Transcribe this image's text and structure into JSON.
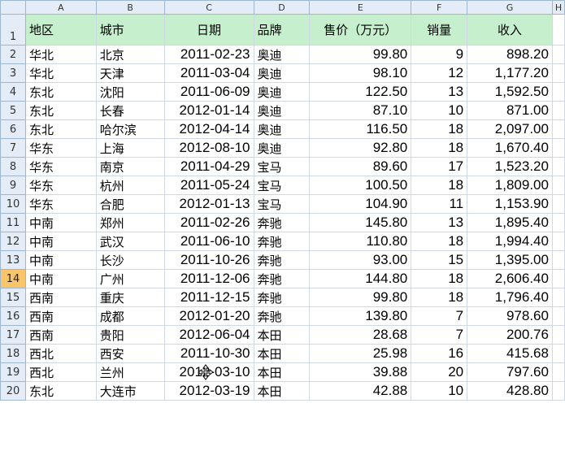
{
  "columns": [
    "A",
    "B",
    "C",
    "D",
    "E",
    "F",
    "G",
    "H"
  ],
  "headers": [
    "地区",
    "城市",
    "日期",
    "品牌",
    "售价（万元）",
    "销量",
    "收入"
  ],
  "rows": [
    {
      "n": "2",
      "region": "华北",
      "city": "北京",
      "date": "2011-02-23",
      "brand": "奥迪",
      "price": "99.80",
      "qty": "9",
      "revenue": "898.20"
    },
    {
      "n": "3",
      "region": "华北",
      "city": "天津",
      "date": "2011-03-04",
      "brand": "奥迪",
      "price": "98.10",
      "qty": "12",
      "revenue": "1,177.20"
    },
    {
      "n": "4",
      "region": "东北",
      "city": "沈阳",
      "date": "2011-06-09",
      "brand": "奥迪",
      "price": "122.50",
      "qty": "13",
      "revenue": "1,592.50"
    },
    {
      "n": "5",
      "region": "东北",
      "city": "长春",
      "date": "2012-01-14",
      "brand": "奥迪",
      "price": "87.10",
      "qty": "10",
      "revenue": "871.00"
    },
    {
      "n": "6",
      "region": "东北",
      "city": "哈尔滨",
      "date": "2012-04-14",
      "brand": "奥迪",
      "price": "116.50",
      "qty": "18",
      "revenue": "2,097.00"
    },
    {
      "n": "7",
      "region": "华东",
      "city": "上海",
      "date": "2012-08-10",
      "brand": "奥迪",
      "price": "92.80",
      "qty": "18",
      "revenue": "1,670.40"
    },
    {
      "n": "8",
      "region": "华东",
      "city": "南京",
      "date": "2011-04-29",
      "brand": "宝马",
      "price": "89.60",
      "qty": "17",
      "revenue": "1,523.20"
    },
    {
      "n": "9",
      "region": "华东",
      "city": "杭州",
      "date": "2011-05-24",
      "brand": "宝马",
      "price": "100.50",
      "qty": "18",
      "revenue": "1,809.00"
    },
    {
      "n": "10",
      "region": "华东",
      "city": "合肥",
      "date": "2012-01-13",
      "brand": "宝马",
      "price": "104.90",
      "qty": "11",
      "revenue": "1,153.90"
    },
    {
      "n": "11",
      "region": "中南",
      "city": "郑州",
      "date": "2011-02-26",
      "brand": "奔驰",
      "price": "145.80",
      "qty": "13",
      "revenue": "1,895.40"
    },
    {
      "n": "12",
      "region": "中南",
      "city": "武汉",
      "date": "2011-06-10",
      "brand": "奔驰",
      "price": "110.80",
      "qty": "18",
      "revenue": "1,994.40"
    },
    {
      "n": "13",
      "region": "中南",
      "city": "长沙",
      "date": "2011-10-26",
      "brand": "奔驰",
      "price": "93.00",
      "qty": "15",
      "revenue": "1,395.00"
    },
    {
      "n": "14",
      "region": "中南",
      "city": "广州",
      "date": "2011-12-06",
      "brand": "奔驰",
      "price": "144.80",
      "qty": "18",
      "revenue": "2,606.40"
    },
    {
      "n": "15",
      "region": "西南",
      "city": "重庆",
      "date": "2011-12-15",
      "brand": "奔驰",
      "price": "99.80",
      "qty": "18",
      "revenue": "1,796.40"
    },
    {
      "n": "16",
      "region": "西南",
      "city": "成都",
      "date": "2012-01-20",
      "brand": "奔驰",
      "price": "139.80",
      "qty": "7",
      "revenue": "978.60"
    },
    {
      "n": "17",
      "region": "西南",
      "city": "贵阳",
      "date": "2012-06-04",
      "brand": "本田",
      "price": "28.68",
      "qty": "7",
      "revenue": "200.76"
    },
    {
      "n": "18",
      "region": "西北",
      "city": "西安",
      "date": "2011-10-30",
      "brand": "本田",
      "price": "25.98",
      "qty": "16",
      "revenue": "415.68"
    },
    {
      "n": "19",
      "region": "西北",
      "city": "兰州",
      "date": "2012-03-10",
      "brand": "本田",
      "price": "39.88",
      "qty": "20",
      "revenue": "797.60"
    },
    {
      "n": "20",
      "region": "东北",
      "city": "大连市",
      "date": "2012-03-19",
      "brand": "本田",
      "price": "42.88",
      "qty": "10",
      "revenue": "428.80"
    }
  ],
  "active_row": "14",
  "colors": {
    "header_fill": "#c6efce",
    "gridline": "#d0d7e5",
    "row_header": "#e4ecf7",
    "active_row_header": "#f8c56b"
  },
  "cursor": "move-cursor-icon"
}
